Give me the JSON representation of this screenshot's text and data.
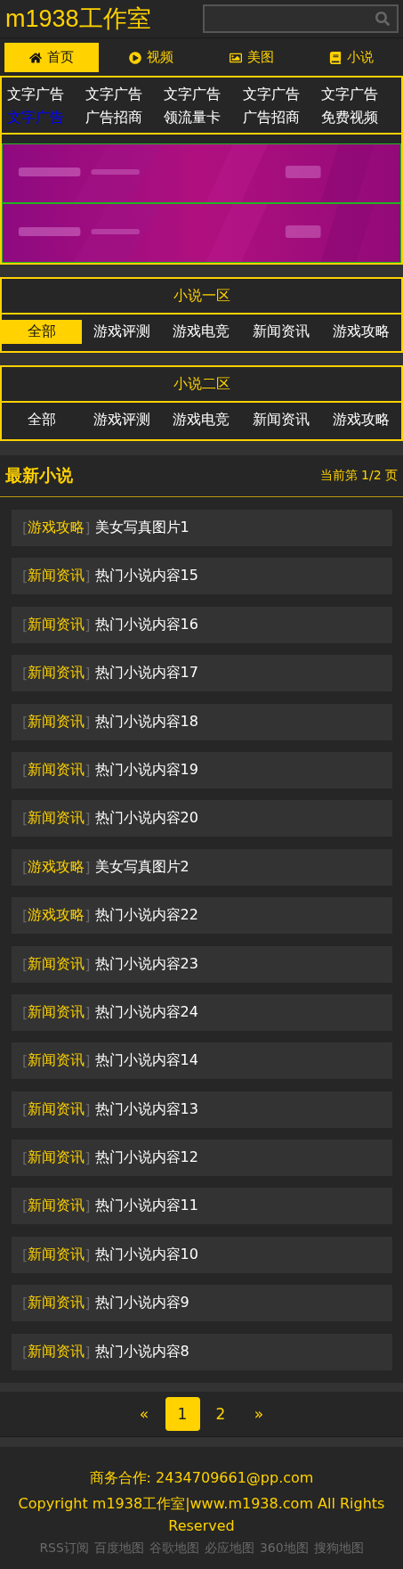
{
  "header": {
    "title": "m1938工作室"
  },
  "nav": [
    {
      "label": "首页",
      "selected": true
    },
    {
      "label": "视频",
      "selected": false
    },
    {
      "label": "美图",
      "selected": false
    },
    {
      "label": "小说",
      "selected": false
    }
  ],
  "text_ads": [
    {
      "label": "文字广告",
      "color": "#ffffff"
    },
    {
      "label": "文字广告",
      "color": "#ffffff"
    },
    {
      "label": "文字广告",
      "color": "#ffffff"
    },
    {
      "label": "文字广告",
      "color": "#ffffff"
    },
    {
      "label": "文字广告",
      "color": "#ffffff"
    },
    {
      "label": "文字广告",
      "color": "#0000ff"
    },
    {
      "label": "广告招商",
      "color": "#ffffff"
    },
    {
      "label": "领流量卡",
      "color": "#ffffff"
    },
    {
      "label": "广告招商",
      "color": "#ffffff"
    },
    {
      "label": "免费视频",
      "color": "#ffffff"
    }
  ],
  "sections": [
    {
      "title": "小说一区",
      "tabs": [
        {
          "label": "全部",
          "selected": true
        },
        {
          "label": "游戏评测",
          "selected": false
        },
        {
          "label": "游戏电竞",
          "selected": false
        },
        {
          "label": "新闻资讯",
          "selected": false
        },
        {
          "label": "游戏攻略",
          "selected": false
        }
      ]
    },
    {
      "title": "小说二区",
      "tabs": [
        {
          "label": "全部",
          "selected": false
        },
        {
          "label": "游戏评测",
          "selected": false
        },
        {
          "label": "游戏电竞",
          "selected": false
        },
        {
          "label": "新闻资讯",
          "selected": false
        },
        {
          "label": "游戏攻略",
          "selected": false
        }
      ]
    }
  ],
  "latest": {
    "title": "最新小说",
    "page_info": "当前第 1/2 页",
    "bracket_open": [
      "[",
      "[",
      "[",
      "[",
      "[",
      "[",
      "[",
      "[",
      "[",
      "[",
      "[",
      "[",
      "[",
      "[",
      "[",
      "[",
      "[",
      "["
    ],
    "bracket_close": [
      "]",
      "]",
      "]",
      "]",
      "]",
      "]",
      "]",
      "]",
      "]",
      "]",
      "]",
      "]",
      "]",
      "]",
      "]",
      "]",
      "]",
      "]"
    ],
    "items": [
      {
        "category": "游戏攻略",
        "title": "美女写真图片1"
      },
      {
        "category": "新闻资讯",
        "title": "热门小说内容15"
      },
      {
        "category": "新闻资讯",
        "title": "热门小说内容16"
      },
      {
        "category": "新闻资讯",
        "title": "热门小说内容17"
      },
      {
        "category": "新闻资讯",
        "title": "热门小说内容18"
      },
      {
        "category": "新闻资讯",
        "title": "热门小说内容19"
      },
      {
        "category": "新闻资讯",
        "title": "热门小说内容20"
      },
      {
        "category": "游戏攻略",
        "title": "美女写真图片2"
      },
      {
        "category": "游戏攻略",
        "title": "热门小说内容22"
      },
      {
        "category": "新闻资讯",
        "title": "热门小说内容23"
      },
      {
        "category": "新闻资讯",
        "title": "热门小说内容24"
      },
      {
        "category": "新闻资讯",
        "title": "热门小说内容14"
      },
      {
        "category": "新闻资讯",
        "title": "热门小说内容13"
      },
      {
        "category": "新闻资讯",
        "title": "热门小说内容12"
      },
      {
        "category": "新闻资讯",
        "title": "热门小说内容11"
      },
      {
        "category": "新闻资讯",
        "title": "热门小说内容10"
      },
      {
        "category": "新闻资讯",
        "title": "热门小说内容9"
      },
      {
        "category": "新闻资讯",
        "title": "热门小说内容8"
      }
    ]
  },
  "pagination": [
    {
      "label": "«",
      "selected": false
    },
    {
      "label": "1",
      "selected": true
    },
    {
      "label": "2",
      "selected": false
    },
    {
      "label": "»",
      "selected": false
    }
  ],
  "footer": {
    "contact": "商务合作: 2434709661@pp.com",
    "copyright": "Copyright m1938工作室|www.m1938.com All Rights Reserved",
    "links": [
      "RSS订阅",
      "百度地图",
      "谷歌地图",
      "必应地图",
      "360地图",
      "搜狗地图"
    ]
  }
}
